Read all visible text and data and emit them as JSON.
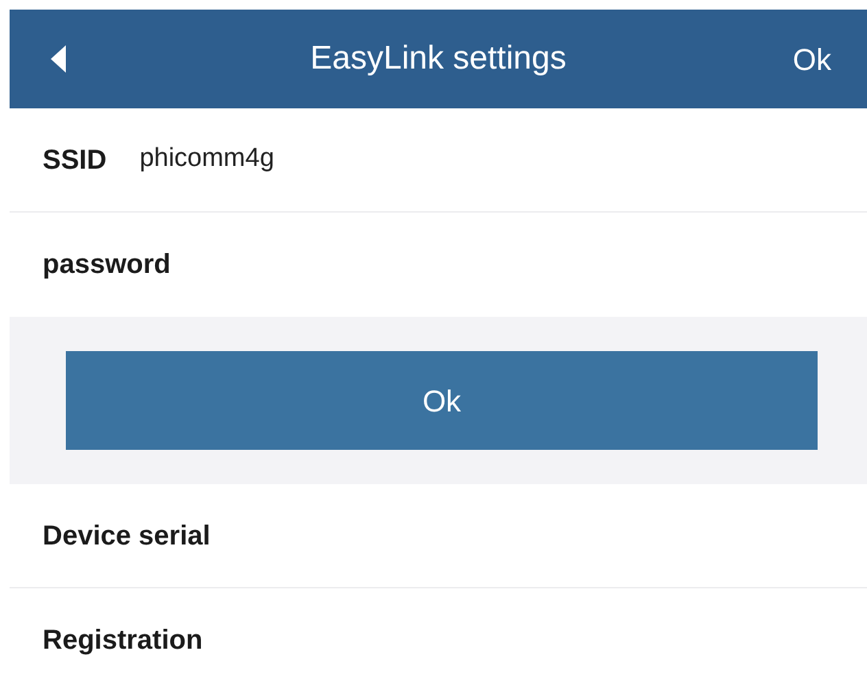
{
  "header": {
    "title": "EasyLink settings",
    "action": "Ok"
  },
  "fields": [
    {
      "label": "SSID",
      "value": "phicomm4g"
    },
    {
      "label": "password"
    }
  ],
  "submit_button": "Ok",
  "rows": [
    {
      "label": "Device serial"
    },
    {
      "label": "Registration"
    }
  ]
}
